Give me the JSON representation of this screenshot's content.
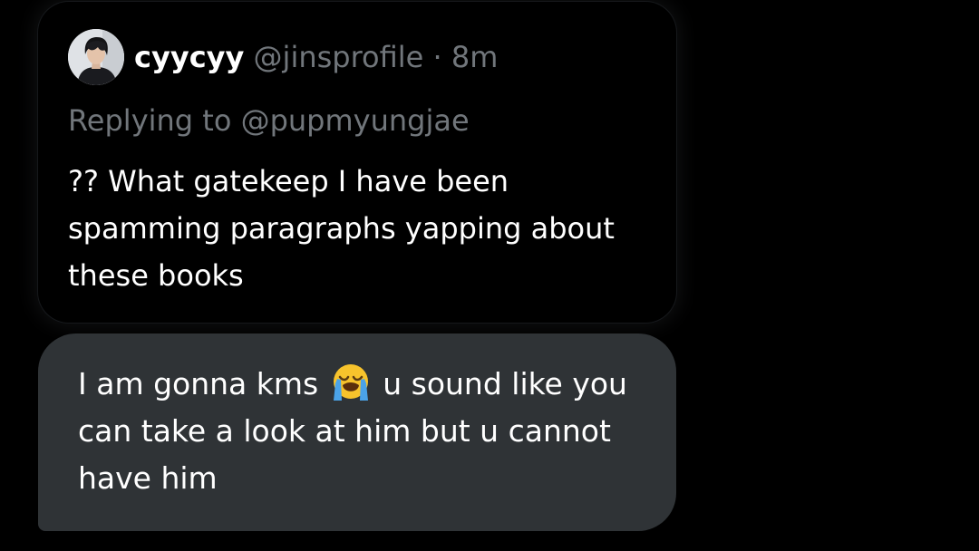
{
  "quoted_post": {
    "author_name": "cyycyy",
    "author_handle": "@jinsprofile",
    "separator": "·",
    "time": "8m",
    "reply_prefix": "Replying to",
    "reply_handle": "@pupmyungjae",
    "text": "?? What gatekeep I have been spamming paragraphs yapping about these books",
    "avatar_icon": "profile-photo"
  },
  "message": {
    "text_before_emoji": "I am gonna kms",
    "emoji": "loudly-crying-face",
    "text_after_emoji": "u sound like you can take a look at him but u cannot have him"
  },
  "colors": {
    "background": "#000000",
    "bubble": "#2f3336",
    "muted_text": "#71767b",
    "text": "#ffffff"
  }
}
